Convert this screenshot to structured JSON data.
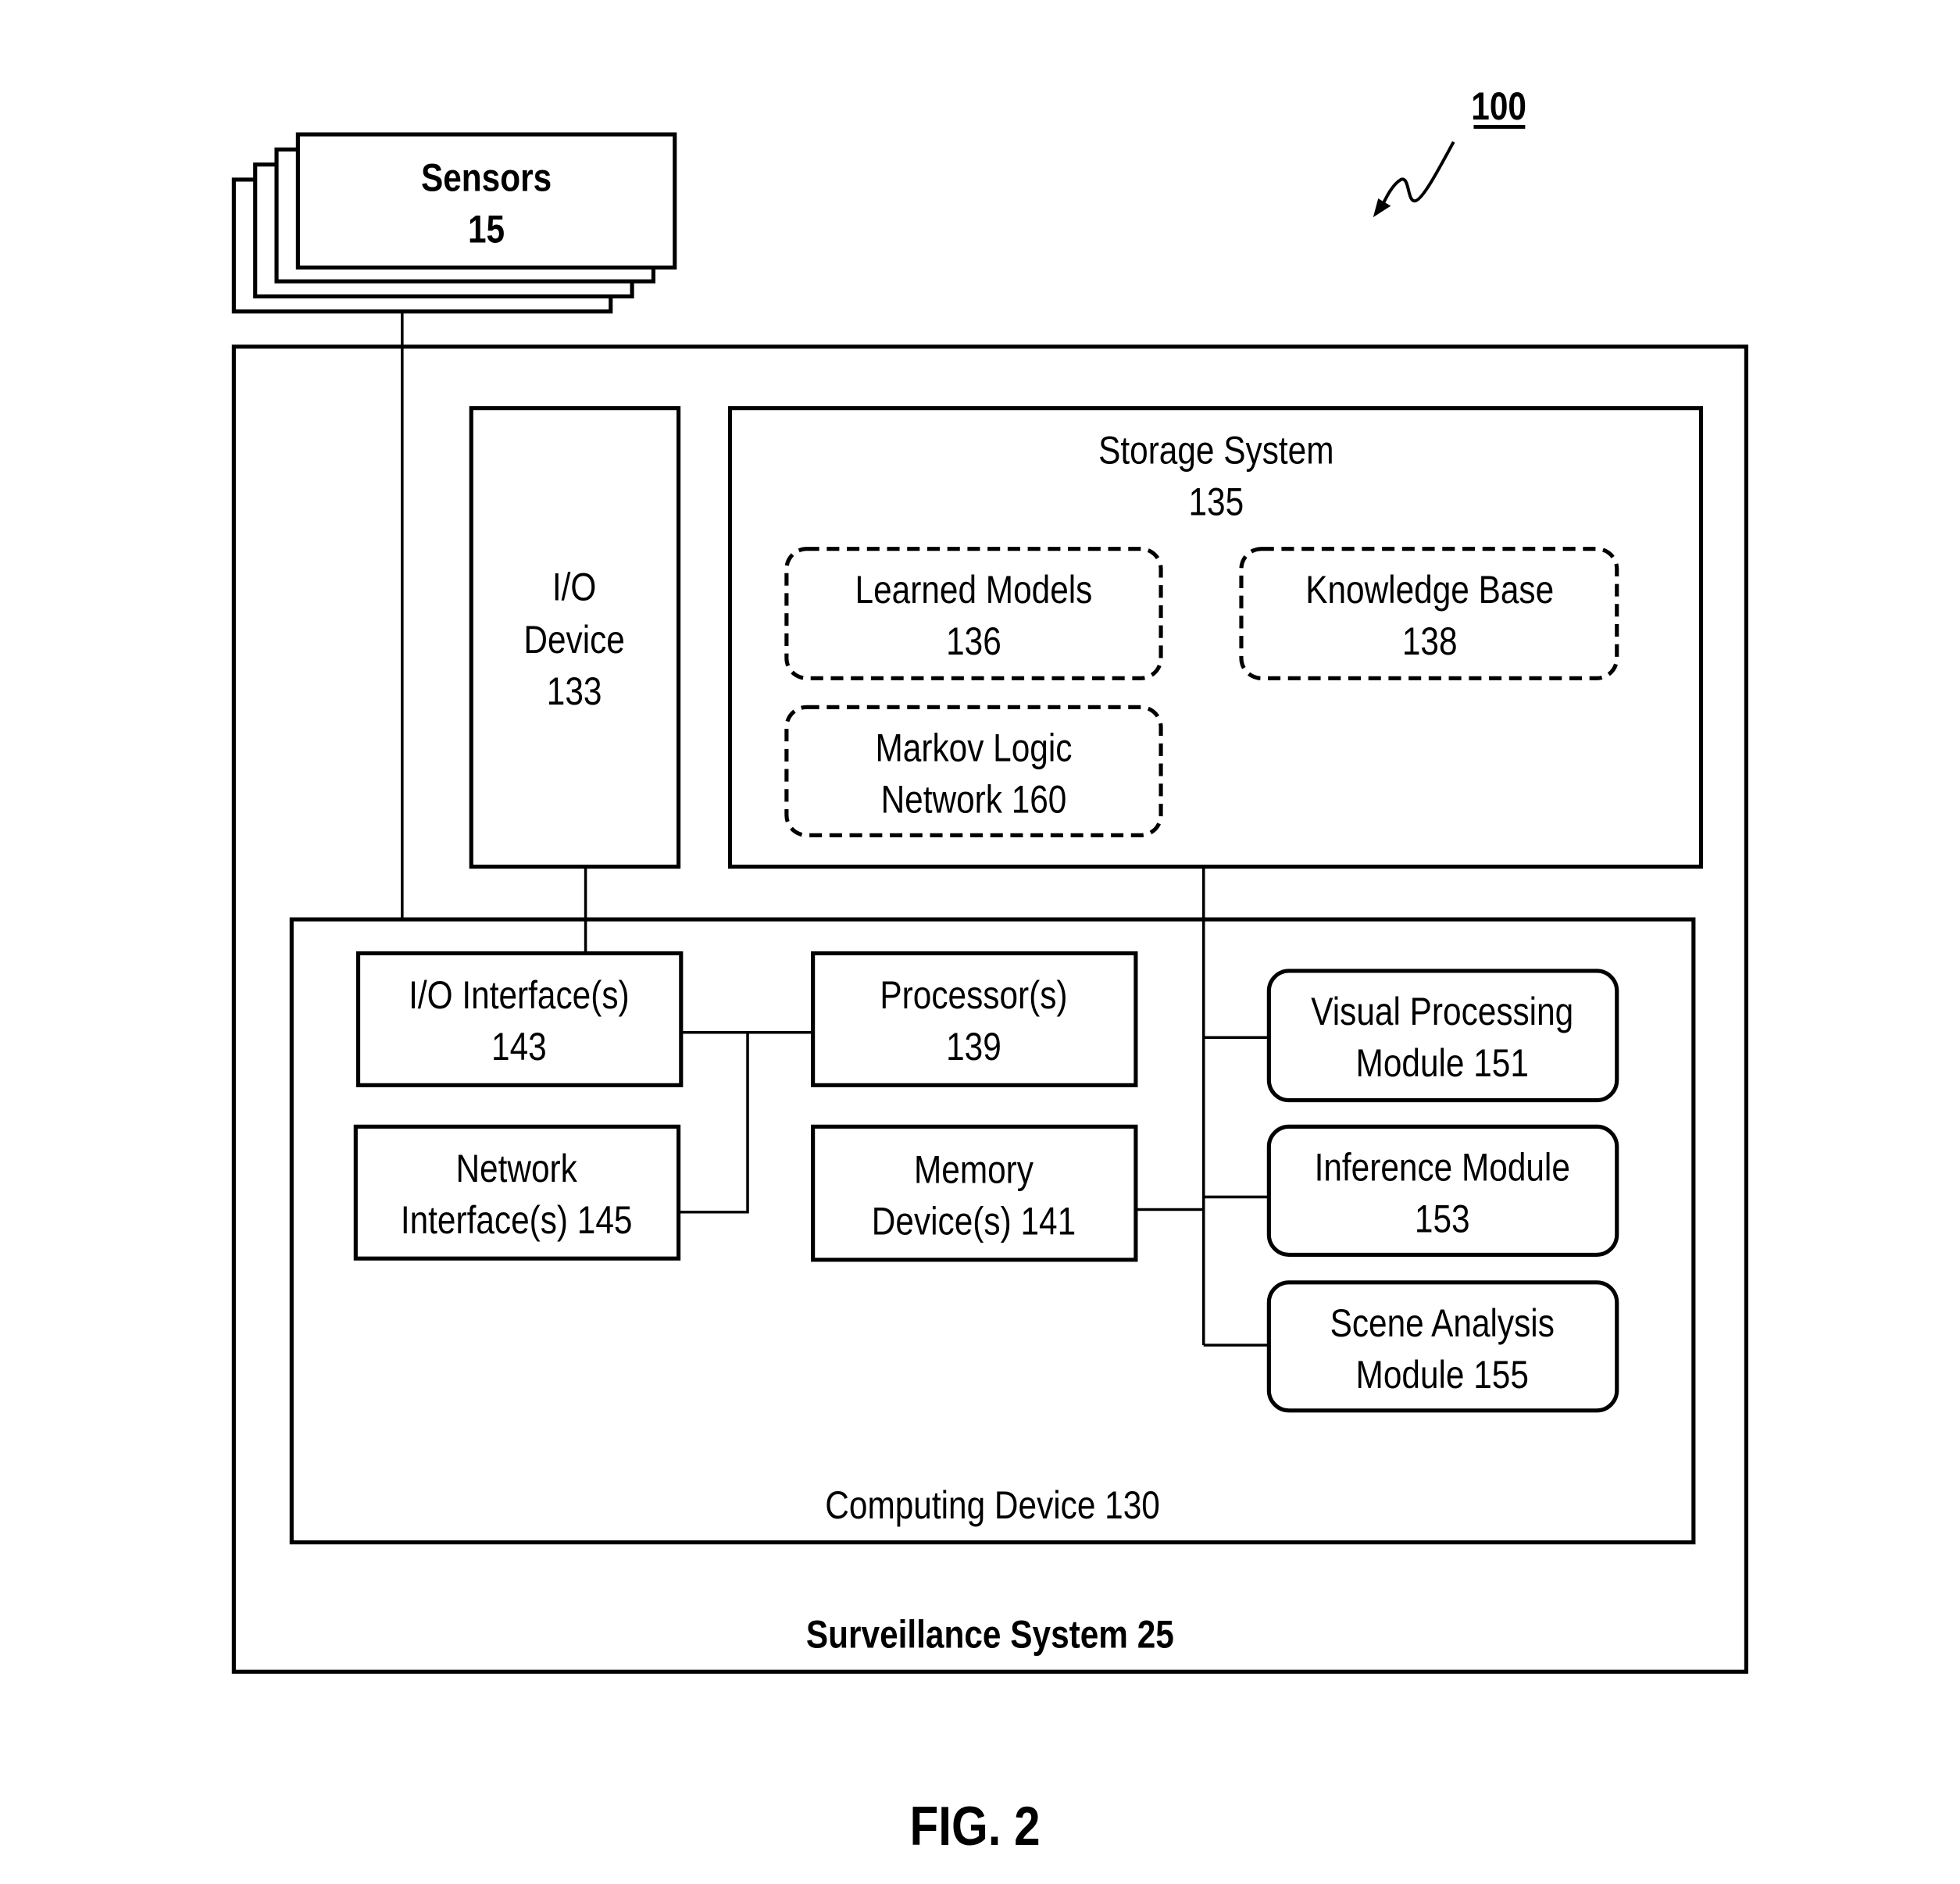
{
  "reference_numeral": "100",
  "figure_label": "FIG. 2",
  "sensors": {
    "line1": "Sensors",
    "line2": "15"
  },
  "surveillance_system": {
    "label": "Surveillance System 25"
  },
  "io_device": {
    "line1": "I/O",
    "line2": "Device",
    "line3": "133"
  },
  "storage_system": {
    "line1": "Storage System",
    "line2": "135",
    "learned_models": {
      "line1": "Learned Models",
      "line2": "136"
    },
    "knowledge_base": {
      "line1": "Knowledge Base",
      "line2": "138"
    },
    "markov_logic": {
      "line1": "Markov Logic",
      "line2": "Network 160"
    }
  },
  "computing_device": {
    "label": "Computing Device 130",
    "io_interface": {
      "line1": "I/O Interface(s)",
      "line2": "143"
    },
    "network_interface": {
      "line1": "Network",
      "line2": "Interface(s) 145"
    },
    "processor": {
      "line1": "Processor(s)",
      "line2": "139"
    },
    "memory": {
      "line1": "Memory",
      "line2": "Device(s) 141"
    },
    "visual_processing": {
      "line1": "Visual Processing",
      "line2": "Module 151"
    },
    "inference": {
      "line1": "Inference Module",
      "line2": "153"
    },
    "scene_analysis": {
      "line1": "Scene Analysis",
      "line2": "Module 155"
    }
  }
}
